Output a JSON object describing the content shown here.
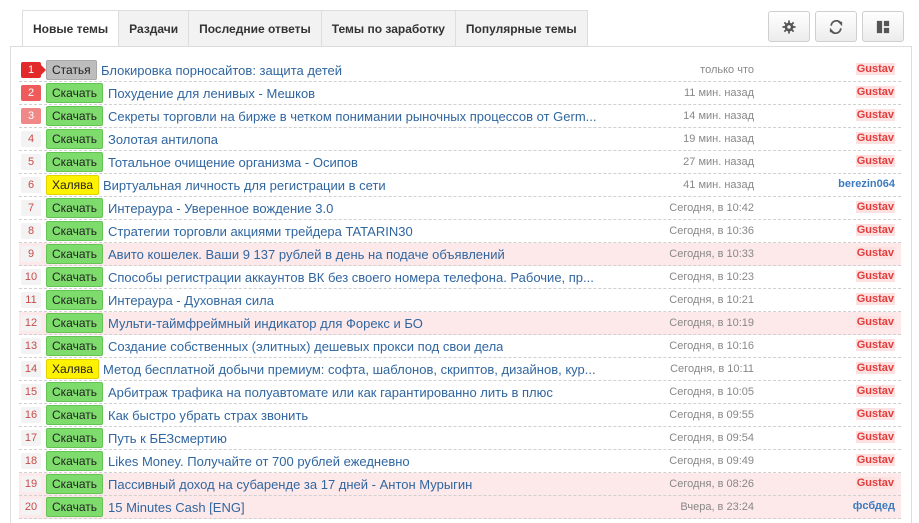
{
  "tabs": [
    {
      "label": "Новые темы",
      "active": true
    },
    {
      "label": "Раздачи",
      "active": false
    },
    {
      "label": "Последние ответы",
      "active": false
    },
    {
      "label": "Темы по заработку",
      "active": false
    },
    {
      "label": "Популярные темы",
      "active": false
    }
  ],
  "toolbar": {
    "settings_icon": "gear-icon",
    "refresh_icon": "refresh-icon",
    "layout_icon": "layout-icon"
  },
  "colors": {
    "tag_download": "#7ddc6c",
    "tag_article": "#bdbdbd",
    "tag_free": "#fff200",
    "highlight_row": "#fde9ea",
    "link": "#3066a0",
    "user_red": "#e43c3c",
    "user_blue": "#3c7bc0"
  },
  "threads": [
    {
      "num": "1",
      "tag": "Статья",
      "tag_type": "article",
      "title": "Блокировка порносайтов: защита детей",
      "time": "только что",
      "user": "Gustav",
      "user_type": "gustav",
      "highlight": false
    },
    {
      "num": "2",
      "tag": "Скачать",
      "tag_type": "download",
      "title": "Похудение для ленивых - Мешков",
      "time": "11 мин. назад",
      "user": "Gustav",
      "user_type": "gustav",
      "highlight": false
    },
    {
      "num": "3",
      "tag": "Скачать",
      "tag_type": "download",
      "title": "Секреты торговли на бирже в четком понимании рыночных процессов от Germ...",
      "time": "14 мин. назад",
      "user": "Gustav",
      "user_type": "gustav",
      "highlight": false
    },
    {
      "num": "4",
      "tag": "Скачать",
      "tag_type": "download",
      "title": "Золотая антилопа",
      "time": "19 мин. назад",
      "user": "Gustav",
      "user_type": "gustav",
      "highlight": false
    },
    {
      "num": "5",
      "tag": "Скачать",
      "tag_type": "download",
      "title": "Тотальное очищение организма - Осипов",
      "time": "27 мин. назад",
      "user": "Gustav",
      "user_type": "gustav",
      "highlight": false
    },
    {
      "num": "6",
      "tag": "Халява",
      "tag_type": "free",
      "title": "Виртуальная личность для регистрации в сети",
      "time": "41 мин. назад",
      "user": "berezin064",
      "user_type": "blue",
      "highlight": false
    },
    {
      "num": "7",
      "tag": "Скачать",
      "tag_type": "download",
      "title": "Интераура - Уверенное вождение 3.0",
      "time": "Сегодня, в 10:42",
      "user": "Gustav",
      "user_type": "gustav",
      "highlight": false
    },
    {
      "num": "8",
      "tag": "Скачать",
      "tag_type": "download",
      "title": "Стратегии торговли акциями трейдера TATARIN30",
      "time": "Сегодня, в 10:36",
      "user": "Gustav",
      "user_type": "gustav",
      "highlight": false
    },
    {
      "num": "9",
      "tag": "Скачать",
      "tag_type": "download",
      "title": "Авито кошелек. Ваши 9 137 рублей в день на подаче объявлений",
      "time": "Сегодня, в 10:33",
      "user": "Gustav",
      "user_type": "gustav",
      "highlight": true
    },
    {
      "num": "10",
      "tag": "Скачать",
      "tag_type": "download",
      "title": "Способы регистрации аккаунтов ВК без своего номера телефона. Рабочие, пр...",
      "time": "Сегодня, в 10:23",
      "user": "Gustav",
      "user_type": "gustav",
      "highlight": false
    },
    {
      "num": "11",
      "tag": "Скачать",
      "tag_type": "download",
      "title": "Интераура - Духовная сила",
      "time": "Сегодня, в 10:21",
      "user": "Gustav",
      "user_type": "gustav",
      "highlight": false
    },
    {
      "num": "12",
      "tag": "Скачать",
      "tag_type": "download",
      "title": "Мульти-таймфреймный индикатор для Форекс и БО",
      "time": "Сегодня, в 10:19",
      "user": "Gustav",
      "user_type": "gustav",
      "highlight": true
    },
    {
      "num": "13",
      "tag": "Скачать",
      "tag_type": "download",
      "title": "Создание собственных (элитных) дешевых прокси под свои дела",
      "time": "Сегодня, в 10:16",
      "user": "Gustav",
      "user_type": "gustav",
      "highlight": false
    },
    {
      "num": "14",
      "tag": "Халява",
      "tag_type": "free",
      "title": "Метод бесплатной добычи премиум: софта, шаблонов, скриптов, дизайнов, кур...",
      "time": "Сегодня, в 10:11",
      "user": "Gustav",
      "user_type": "gustav",
      "highlight": false
    },
    {
      "num": "15",
      "tag": "Скачать",
      "tag_type": "download",
      "title": "Арбитраж трафика на полуавтомате или как гарантированно лить в плюс",
      "time": "Сегодня, в 10:05",
      "user": "Gustav",
      "user_type": "gustav",
      "highlight": false
    },
    {
      "num": "16",
      "tag": "Скачать",
      "tag_type": "download",
      "title": "Как быстро убрать страх звонить",
      "time": "Сегодня, в 09:55",
      "user": "Gustav",
      "user_type": "gustav",
      "highlight": false
    },
    {
      "num": "17",
      "tag": "Скачать",
      "tag_type": "download",
      "title": "Путь к БЕЗсмертию",
      "time": "Сегодня, в 09:54",
      "user": "Gustav",
      "user_type": "gustav",
      "highlight": false
    },
    {
      "num": "18",
      "tag": "Скачать",
      "tag_type": "download",
      "title": "Likes Money. Получайте от 700 рублей ежедневно",
      "time": "Сегодня, в 09:49",
      "user": "Gustav",
      "user_type": "gustav",
      "highlight": false
    },
    {
      "num": "19",
      "tag": "Скачать",
      "tag_type": "download",
      "title": "Пассивный доход на субаренде за 17 дней - Антон Мурыгин",
      "time": "Сегодня, в 08:26",
      "user": "Gustav",
      "user_type": "gustav",
      "highlight": true
    },
    {
      "num": "20",
      "tag": "Скачать",
      "tag_type": "download",
      "title": "15 Minutes Cash [ENG]",
      "time": "Вчера, в 23:24",
      "user": "фсбдед",
      "user_type": "blue",
      "highlight": true
    }
  ]
}
